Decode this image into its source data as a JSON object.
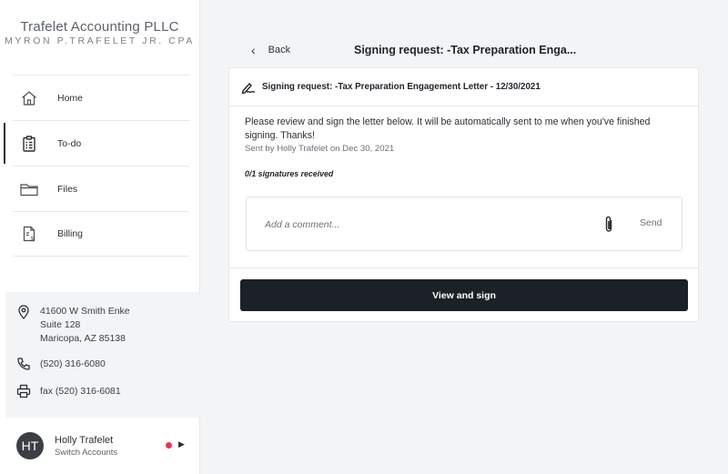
{
  "brand": {
    "title": "Trafelet Accounting PLLC",
    "subtitle": "MYRON P.TRAFELET JR. CPA"
  },
  "nav": [
    {
      "label": "Home",
      "icon": "home-icon",
      "active": false
    },
    {
      "label": "To-do",
      "icon": "clipboard-icon",
      "active": true
    },
    {
      "label": "Files",
      "icon": "folder-icon",
      "active": false
    },
    {
      "label": "Billing",
      "icon": "invoice-icon",
      "active": false
    }
  ],
  "contact": {
    "address_line1": "41600 W Smith Enke",
    "address_line2": "Suite 128",
    "address_line3": "Maricopa, AZ 85138",
    "phone": "(520) 316-6080",
    "fax": "fax (520) 316-6081"
  },
  "user": {
    "initials": "HT",
    "name": "Holly Trafelet",
    "switch_label": "Switch Accounts",
    "status_color": "#e8345a"
  },
  "header": {
    "back_label": "Back",
    "title": "Signing request: -Tax Preparation Enga..."
  },
  "card": {
    "title": "Signing request: -Tax Preparation Engagement Letter - 12/30/2021",
    "message": "Please review and sign the letter below. It will be automatically sent to me when you've finished signing. Thanks!",
    "sent_by": "Sent by Holly Trafelet on Dec 30, 2021",
    "signatures": "0/1 signatures received",
    "comment_placeholder": "Add a comment...",
    "send_label": "Send",
    "primary_button": "View and sign"
  },
  "colors": {
    "primary": "#1c2027",
    "sidebar_bg": "#ffffff",
    "content_bg": "#f3f4f6",
    "status_dot": "#e8345a"
  }
}
